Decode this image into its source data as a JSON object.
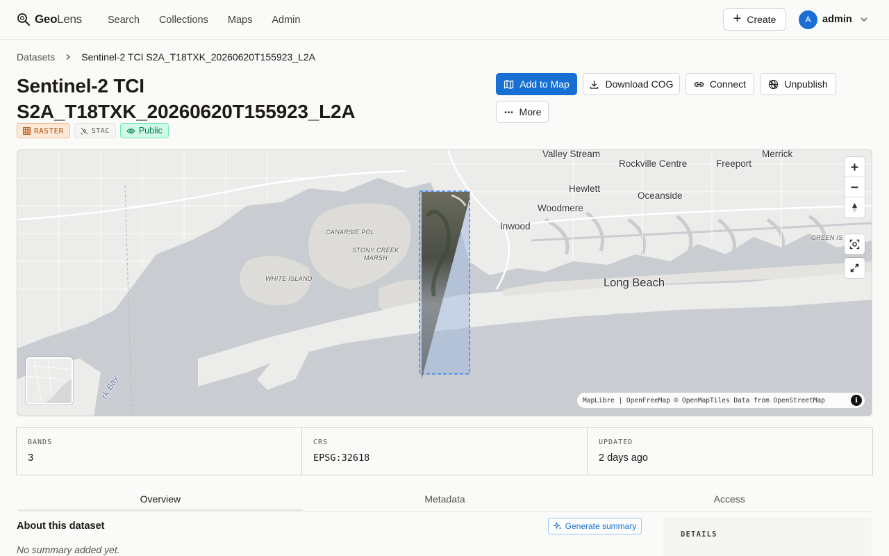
{
  "app": {
    "brand_bold": "Geo",
    "brand_light": "Lens",
    "nav": [
      "Search",
      "Collections",
      "Maps",
      "Admin"
    ],
    "create_label": "Create",
    "user": {
      "initial": "A",
      "name": "admin"
    }
  },
  "breadcrumb": {
    "parent": "Datasets",
    "current": "Sentinel-2 TCI S2A_T18TXK_20260620T155923_L2A"
  },
  "dataset": {
    "title_line1": "Sentinel-2 TCI",
    "title_line2": "S2A_T18TXK_20260620T155923_L2A",
    "badges": {
      "type": "RASTER",
      "source": "STAC",
      "visibility": "Public"
    }
  },
  "actions": {
    "add_to_map": "Add to Map",
    "download": "Download COG",
    "connect": "Connect",
    "unpublish": "Unpublish",
    "more": "More"
  },
  "map": {
    "labels": {
      "valley_stream": "Valley Stream",
      "rockville_centre": "Rockville Centre",
      "freeport": "Freeport",
      "merrick": "Merrick",
      "hewlett": "Hewlett",
      "oceanside": "Oceanside",
      "woodmere": "Woodmere",
      "inwood": "Inwood",
      "long_beach": "Long Beach",
      "canarsie_pol": "CANARSIE POL",
      "stony_creek_marsh_1": "STONY CREEK",
      "stony_creek_marsh_2": "MARSH",
      "white_island": "WHITE ISLAND",
      "green_island": "GREEN IS",
      "bay": "rk Bay"
    },
    "attribution": "MapLibre | OpenFreeMap © OpenMapTiles Data from OpenStreetMap",
    "info_glyph": "i",
    "colors": {
      "water": "#c9ccd0",
      "land": "#ececea",
      "footprint": "#3b82f6"
    }
  },
  "stats": [
    {
      "label": "BANDS",
      "value": "3"
    },
    {
      "label": "CRS",
      "value": "EPSG:32618"
    },
    {
      "label": "UPDATED",
      "value": "2 days ago"
    }
  ],
  "tabs": [
    "Overview",
    "Metadata",
    "Access"
  ],
  "about": {
    "title": "About this dataset",
    "generate_label": "Generate summary",
    "empty_text": "No summary added yet."
  },
  "details": {
    "title": "DETAILS"
  }
}
